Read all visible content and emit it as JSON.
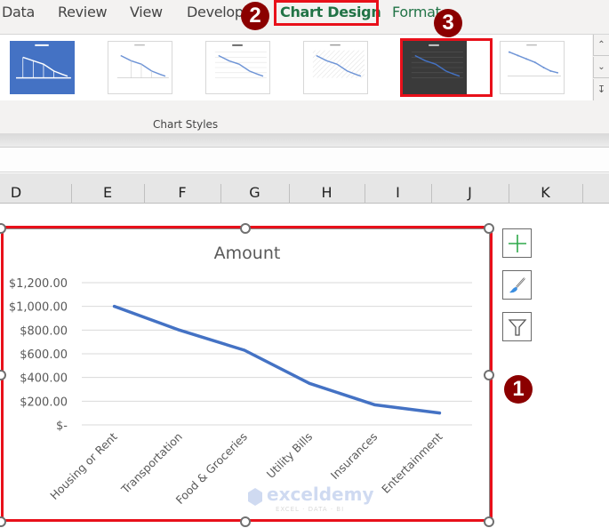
{
  "ribbon": {
    "tabs": [
      {
        "label": "Data",
        "style": "normal"
      },
      {
        "label": "Review",
        "style": "normal"
      },
      {
        "label": "View",
        "style": "normal"
      },
      {
        "label": "Develop",
        "style": "normal"
      },
      {
        "label": "Chart Design",
        "style": "active"
      },
      {
        "label": "Format",
        "style": "green"
      }
    ],
    "group_label": "Chart Styles",
    "gallery": {
      "styles": [
        "Style 1",
        "Style 2",
        "Style 3",
        "Style 4",
        "Style 5",
        "Style 6"
      ],
      "selected_index": 4,
      "scroll_up_icon": "chevron-up",
      "scroll_down_icon": "chevron-down",
      "more_icon": "expand-more"
    }
  },
  "columns": [
    "D",
    "E",
    "F",
    "G",
    "H",
    "I",
    "J",
    "K"
  ],
  "steps": {
    "step1": "1",
    "step2": "2",
    "step3": "3"
  },
  "chart_side_buttons": [
    {
      "name": "chart-elements",
      "icon": "plus"
    },
    {
      "name": "chart-styles",
      "icon": "paintbrush"
    },
    {
      "name": "chart-filters",
      "icon": "funnel"
    }
  ],
  "watermark": {
    "brand": "exceldemy",
    "tagline": "EXCEL · DATA · BI"
  },
  "colors": {
    "series": "#4472c4",
    "accent_green": "#217346",
    "highlight_red": "#e8101a",
    "badge": "#8b0000"
  },
  "chart_data": {
    "type": "line",
    "title": "Amount",
    "xlabel": "",
    "ylabel": "",
    "categories": [
      "Housing or Rent",
      "Transportation",
      "Food & Groceries",
      "Utility Bills",
      "Insurances",
      "Entertainment"
    ],
    "series": [
      {
        "name": "Amount",
        "values": [
          1000,
          800,
          630,
          350,
          170,
          100
        ]
      }
    ],
    "ylim": [
      0,
      1200
    ],
    "yticks": [
      0,
      200,
      400,
      600,
      800,
      1000,
      1200
    ],
    "ytick_labels": [
      "$-",
      "$200.00",
      "$400.00",
      "$600.00",
      "$800.00",
      "$1,000.00",
      "$1,200.00"
    ],
    "grid": true,
    "legend": "none"
  }
}
